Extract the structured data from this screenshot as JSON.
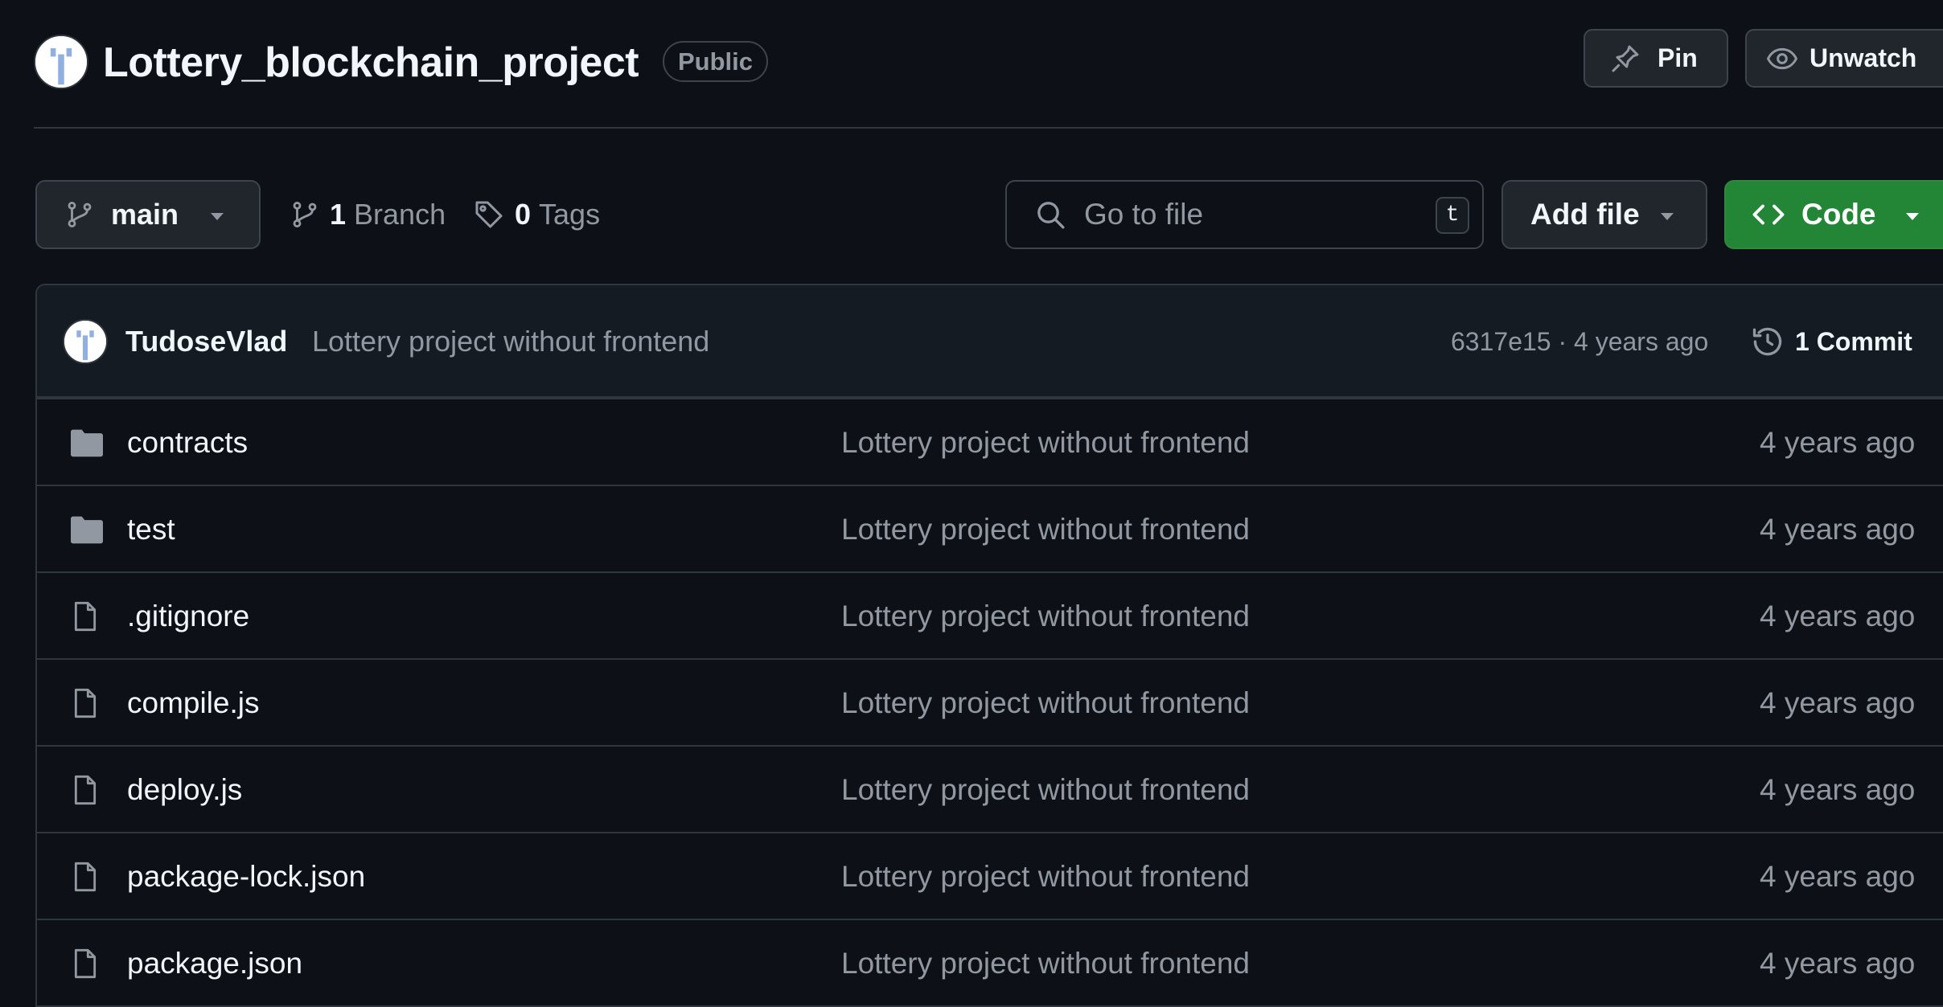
{
  "repo": {
    "name": "Lottery_blockchain_project",
    "visibility": "Public"
  },
  "header_actions": {
    "pin_label": "Pin",
    "unwatch_label": "Unwatch"
  },
  "toolbar": {
    "branch_name": "main",
    "branch_count": "1",
    "branch_label": "Branch",
    "tag_count": "0",
    "tag_label": "Tags",
    "search_placeholder": "Go to file",
    "search_shortcut": "t",
    "add_file_label": "Add file",
    "code_label": "Code"
  },
  "latest_commit": {
    "author": "TudoseVlad",
    "message": "Lottery project without frontend",
    "meta": "6317e15 · 4 years ago",
    "commits_label": "1 Commit"
  },
  "files": [
    {
      "name": "contracts",
      "type": "folder",
      "message": "Lottery project without frontend",
      "age": "4 years ago"
    },
    {
      "name": "test",
      "type": "folder",
      "message": "Lottery project without frontend",
      "age": "4 years ago"
    },
    {
      "name": ".gitignore",
      "type": "file",
      "message": "Lottery project without frontend",
      "age": "4 years ago"
    },
    {
      "name": "compile.js",
      "type": "file",
      "message": "Lottery project without frontend",
      "age": "4 years ago"
    },
    {
      "name": "deploy.js",
      "type": "file",
      "message": "Lottery project without frontend",
      "age": "4 years ago"
    },
    {
      "name": "package-lock.json",
      "type": "file",
      "message": "Lottery project without frontend",
      "age": "4 years ago"
    },
    {
      "name": "package.json",
      "type": "file",
      "message": "Lottery project without frontend",
      "age": "4 years ago"
    }
  ],
  "icons": {
    "folder": "folder-icon",
    "file": "file-icon",
    "branch": "git-branch-icon",
    "tag": "tag-icon",
    "search": "search-icon",
    "pin": "pin-icon",
    "eye": "eye-icon",
    "code": "code-icon",
    "history": "history-icon"
  },
  "colors": {
    "background": "#0d1117",
    "commit_bar": "#151b23",
    "border": "#30363d",
    "primary_text": "#f0f6fc",
    "muted_text": "#9198a1",
    "code_button": "#238636",
    "button_bg": "#21262d"
  }
}
